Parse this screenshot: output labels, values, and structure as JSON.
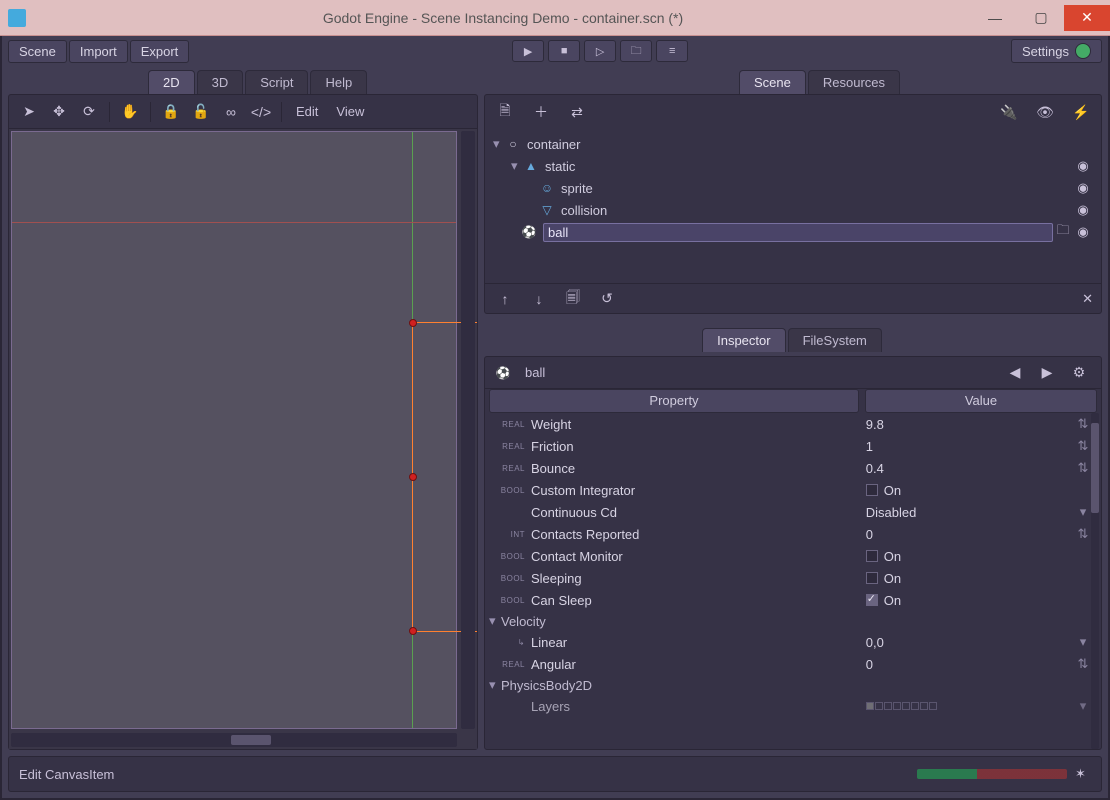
{
  "window": {
    "title": "Godot Engine - Scene Instancing Demo - container.scn (*)"
  },
  "menubar": {
    "scene": "Scene",
    "import": "Import",
    "export": "Export",
    "settings": "Settings"
  },
  "mode_tabs": {
    "d2": "2D",
    "d3": "3D",
    "script": "Script",
    "help": "Help"
  },
  "right_tabs": {
    "scene": "Scene",
    "resources": "Resources"
  },
  "viewport_toolbar": {
    "edit": "Edit",
    "view": "View"
  },
  "scene_tree": {
    "root": "container",
    "children": {
      "static": "static",
      "sprite": "sprite",
      "collision": "collision",
      "ball": "ball"
    }
  },
  "inspector_tabs": {
    "inspector": "Inspector",
    "filesystem": "FileSystem"
  },
  "inspector": {
    "object": "ball",
    "columns": {
      "property": "Property",
      "value": "Value"
    },
    "props": {
      "weight": {
        "kind": "REAL",
        "name": "Weight",
        "value": "9.8"
      },
      "friction": {
        "kind": "REAL",
        "name": "Friction",
        "value": "1"
      },
      "bounce": {
        "kind": "REAL",
        "name": "Bounce",
        "value": "0.4"
      },
      "custom_integr": {
        "kind": "BOOL",
        "name": "Custom Integrator",
        "value": "On",
        "checked": false
      },
      "continuous_cd": {
        "kind": "",
        "name": "Continuous Cd",
        "value": "Disabled"
      },
      "contacts_rep": {
        "kind": "INT",
        "name": "Contacts Reported",
        "value": "0"
      },
      "contact_mon": {
        "kind": "BOOL",
        "name": "Contact Monitor",
        "value": "On",
        "checked": false
      },
      "sleeping": {
        "kind": "BOOL",
        "name": "Sleeping",
        "value": "On",
        "checked": false
      },
      "can_sleep": {
        "kind": "BOOL",
        "name": "Can Sleep",
        "value": "On",
        "checked": true
      },
      "section_velocity": "Velocity",
      "linear": {
        "kind": "",
        "name": "Linear",
        "value": "0,0"
      },
      "angular": {
        "kind": "REAL",
        "name": "Angular",
        "value": "0"
      },
      "section_physics": "PhysicsBody2D",
      "layers": {
        "kind": "",
        "name": "Layers"
      }
    }
  },
  "statusbar": {
    "text": "Edit CanvasItem"
  }
}
